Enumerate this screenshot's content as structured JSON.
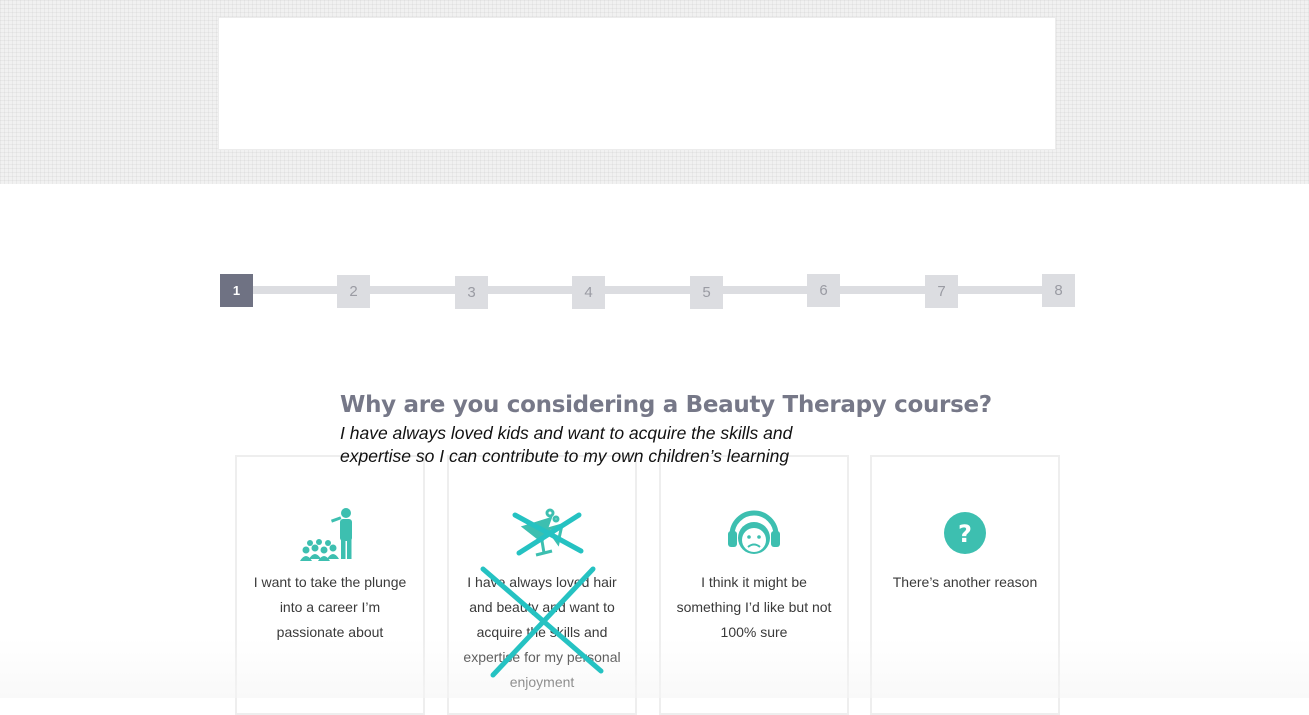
{
  "stepper": {
    "steps": [
      "1",
      "2",
      "3",
      "4",
      "5",
      "6",
      "7",
      "8"
    ],
    "current": 1
  },
  "question": {
    "title": "Why are you considering a Beauty Therapy course?"
  },
  "overlay_note": "I have always loved kids and want to acquire the skills and expertise so I can contribute to my own children’s learning",
  "options": [
    {
      "icon": "presenter-audience-icon",
      "label": "I want to take the plunge into a career I’m passionate about"
    },
    {
      "icon": "cocktail-glass-icon",
      "label": "I have always loved hair and beauty and want to acquire the skills and expertise for my personal enjoyment",
      "crossed_out": true
    },
    {
      "icon": "headphones-face-icon",
      "label": "I think it might be something I’d like but not 100% sure"
    },
    {
      "icon": "question-mark-icon",
      "label": "There’s another reason"
    }
  ],
  "colors": {
    "accent": "#3dbfb0",
    "step_active": "#6f7283",
    "step_inactive": "#dcdde1",
    "cross": "#25c2c2"
  }
}
